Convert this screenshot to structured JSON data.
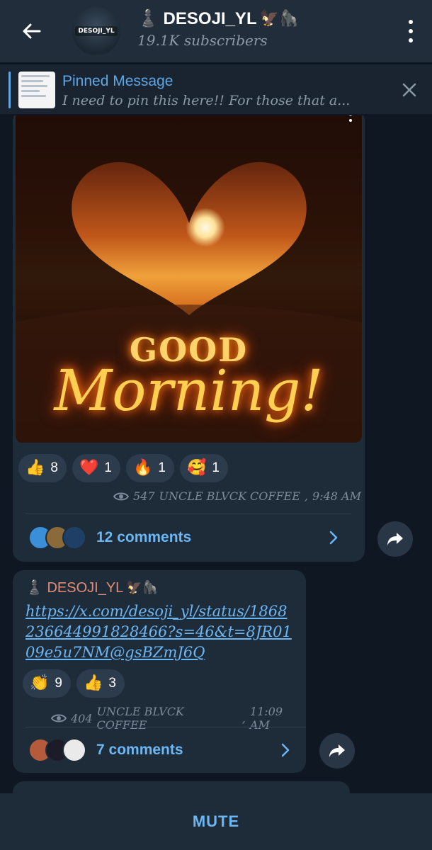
{
  "header": {
    "title": "♟️ DESOJI_YL",
    "title_emoji": "🦅🦍",
    "subscribers": "19.1K subscribers",
    "avatar_logo": "DESOJI_YL"
  },
  "pinned": {
    "title": "Pinned Message",
    "text": "I need to pin this here!!  For those that a..."
  },
  "posts": [
    {
      "image_text_line1": "GOOD",
      "image_text_line2": "Morning!",
      "reactions": [
        {
          "emoji": "👍",
          "count": "8"
        },
        {
          "emoji": "❤️",
          "count": "1"
        },
        {
          "emoji": "🔥",
          "count": "1"
        },
        {
          "emoji": "🥰",
          "count": "1"
        }
      ],
      "views": "547",
      "author": "UNCLE BLVCK COFFEE",
      "time": "9:48 AM",
      "comments": "12 comments"
    },
    {
      "sender": "♟️ DESOJI_YL",
      "sender_emoji": "🦅🦍",
      "link": "https://x.com/desoji_yl/status/1868236644991828466?s=46&t=8JR0109e5u7NM@gsBZmJ6Q",
      "reactions": [
        {
          "emoji": "👏",
          "count": "9"
        },
        {
          "emoji": "👍",
          "count": "3"
        }
      ],
      "views": "404",
      "author": "UNCLE BLVCK COFFEE",
      "time": "11:09 AM",
      "comments": "7 comments"
    }
  ],
  "bottom": {
    "mute_label": "MUTE"
  },
  "colors": {
    "accent": "#6cb6f3",
    "header_bg": "#212d3b",
    "bubble_bg": "#1e2c3a",
    "sender_name": "#e58a74"
  }
}
